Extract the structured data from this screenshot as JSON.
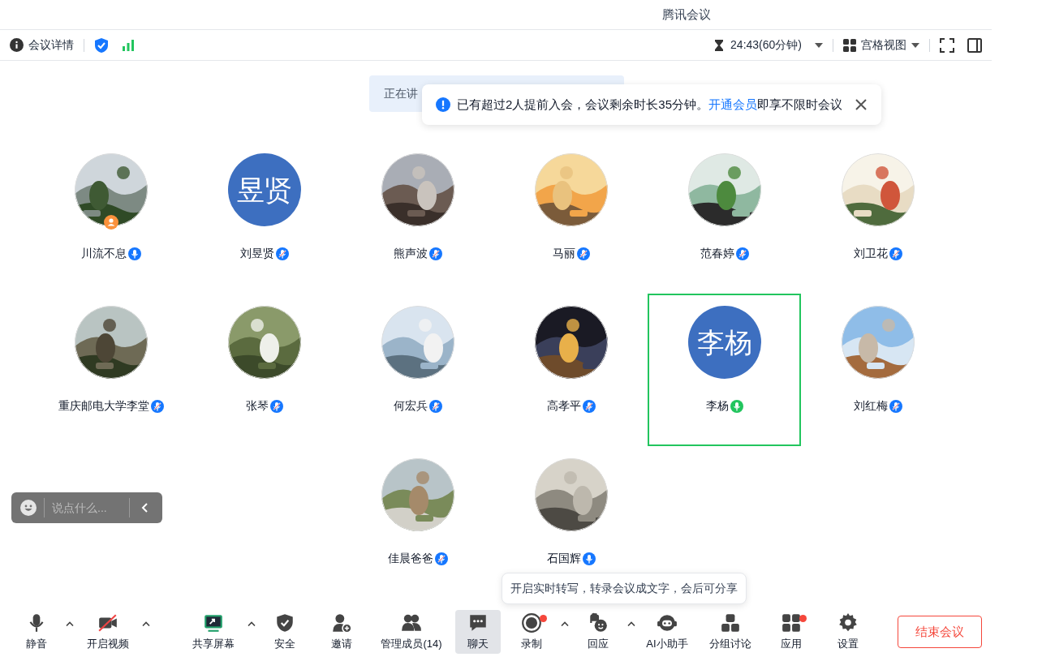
{
  "window": {
    "title": "腾讯会议"
  },
  "top_bar": {
    "details": "会议详情",
    "timer": "24:43(60分钟)",
    "view": "宫格视图"
  },
  "speaking_banner": "正在讲",
  "notice": {
    "text": "已有超过2人提前入会，会议剩余时长35分钟。",
    "link": "开通会员",
    "suffix": "即享不限时会议"
  },
  "participants": [
    {
      "name": "川流不息",
      "kind": "picture",
      "muted": false,
      "speaking": false,
      "host": true,
      "active": false
    },
    {
      "name": "刘昱贤",
      "kind": "text",
      "initials": "昱贤",
      "muted": true,
      "speaking": false,
      "host": false,
      "active": false
    },
    {
      "name": "熊声波",
      "kind": "picture",
      "muted": true,
      "speaking": false,
      "host": false,
      "active": false
    },
    {
      "name": "马丽",
      "kind": "picture",
      "muted": true,
      "speaking": false,
      "host": false,
      "active": false
    },
    {
      "name": "范春婷",
      "kind": "picture",
      "muted": true,
      "speaking": false,
      "host": false,
      "active": false
    },
    {
      "name": "刘卫花",
      "kind": "picture",
      "muted": true,
      "speaking": false,
      "host": false,
      "active": false
    },
    {
      "name": "重庆邮电大学李堂",
      "kind": "picture",
      "muted": true,
      "speaking": false,
      "host": false,
      "active": false
    },
    {
      "name": "张琴",
      "kind": "picture",
      "muted": true,
      "speaking": false,
      "host": false,
      "active": false
    },
    {
      "name": "何宏兵",
      "kind": "picture",
      "muted": true,
      "speaking": false,
      "host": false,
      "active": false
    },
    {
      "name": "高孝平",
      "kind": "picture",
      "muted": true,
      "speaking": false,
      "host": false,
      "active": false
    },
    {
      "name": "李杨",
      "kind": "text",
      "initials": "李杨",
      "muted": false,
      "speaking": true,
      "host": false,
      "active": true
    },
    {
      "name": "刘红梅",
      "kind": "picture",
      "muted": true,
      "speaking": false,
      "host": false,
      "active": false
    },
    {
      "name": "佳晨爸爸",
      "kind": "picture",
      "muted": true,
      "speaking": false,
      "host": false,
      "active": false
    },
    {
      "name": "石国辉",
      "kind": "picture",
      "muted": false,
      "speaking": false,
      "host": false,
      "active": false
    }
  ],
  "chat_input": {
    "placeholder": "说点什么..."
  },
  "tooltip": "开启实时转写，转录会议成文字，会后可分享",
  "toolbar": [
    {
      "label": "静音",
      "caret": true,
      "dot": false,
      "selected": false
    },
    {
      "label": "开启视频",
      "caret": true,
      "dot": false,
      "selected": false
    },
    {
      "label": "共享屏幕",
      "caret": true,
      "dot": false,
      "selected": false
    },
    {
      "label": "安全",
      "caret": false,
      "dot": false,
      "selected": false
    },
    {
      "label": "邀请",
      "caret": false,
      "dot": false,
      "selected": false
    },
    {
      "label": "管理成员(14)",
      "caret": false,
      "dot": false,
      "selected": false
    },
    {
      "label": "聊天",
      "caret": false,
      "dot": false,
      "selected": true
    },
    {
      "label": "录制",
      "caret": true,
      "dot": true,
      "selected": false
    },
    {
      "label": "回应",
      "caret": true,
      "dot": false,
      "selected": false
    },
    {
      "label": "AI小助手",
      "caret": false,
      "dot": false,
      "selected": false
    },
    {
      "label": "分组讨论",
      "caret": false,
      "dot": false,
      "selected": false
    },
    {
      "label": "应用",
      "caret": false,
      "dot": true,
      "selected": false
    },
    {
      "label": "设置",
      "caret": false,
      "dot": false,
      "selected": false
    }
  ],
  "end_button": "结束会议"
}
